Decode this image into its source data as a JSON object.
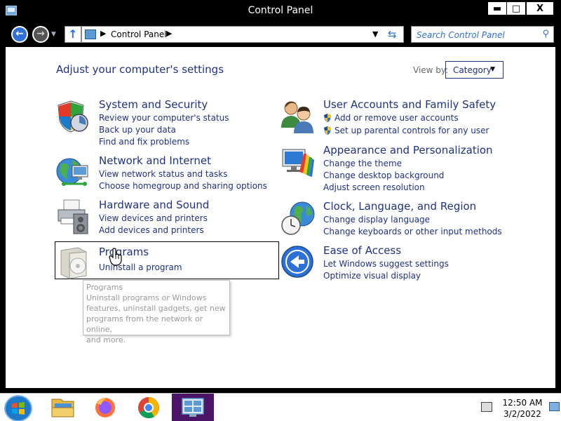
{
  "window": {
    "title": "Control Panel",
    "min_glyph": "▬",
    "max_glyph": "□",
    "close_glyph": "X"
  },
  "addressbar": {
    "breadcrumb": "Control Panel",
    "search_placeholder": "Search Control Panel"
  },
  "content": {
    "heading": "Adjust your computer's settings",
    "view_by_label": "View by:",
    "view_by_value": "Category"
  },
  "categories": {
    "system_security": {
      "title": "System and Security",
      "links": [
        "Review your computer's status",
        "Back up your data",
        "Find and fix problems"
      ]
    },
    "network_internet": {
      "title": "Network and Internet",
      "links": [
        "View network status and tasks",
        "Choose homegroup and sharing options"
      ]
    },
    "hardware_sound": {
      "title": "Hardware and Sound",
      "links": [
        "View devices and printers",
        "Add devices and printers"
      ]
    },
    "programs": {
      "title": "Programs",
      "links": [
        "Uninstall a program"
      ]
    },
    "user_accounts": {
      "title": "User Accounts and Family Safety",
      "links": [
        "Add or remove user accounts",
        "Set up parental controls for any user"
      ]
    },
    "appearance": {
      "title": "Appearance and Personalization",
      "links": [
        "Change the theme",
        "Change desktop background",
        "Adjust screen resolution"
      ]
    },
    "clock_region": {
      "title": "Clock, Language, and Region",
      "links": [
        "Change display language",
        "Change keyboards or other input methods"
      ]
    },
    "ease_access": {
      "title": "Ease of Access",
      "links": [
        "Let Windows suggest settings",
        "Optimize visual display"
      ]
    }
  },
  "tooltip": {
    "title": "Programs",
    "lines": [
      "Uninstall programs or Windows",
      "features, uninstall gadgets, get new",
      "programs from the network or online,",
      "and more."
    ]
  },
  "taskbar": {
    "time": "12:50 AM",
    "date": "3/2/2022"
  },
  "colors": {
    "link": "#1e3287",
    "taskbar_active": "#4b1466",
    "window_chrome": "#000000"
  }
}
